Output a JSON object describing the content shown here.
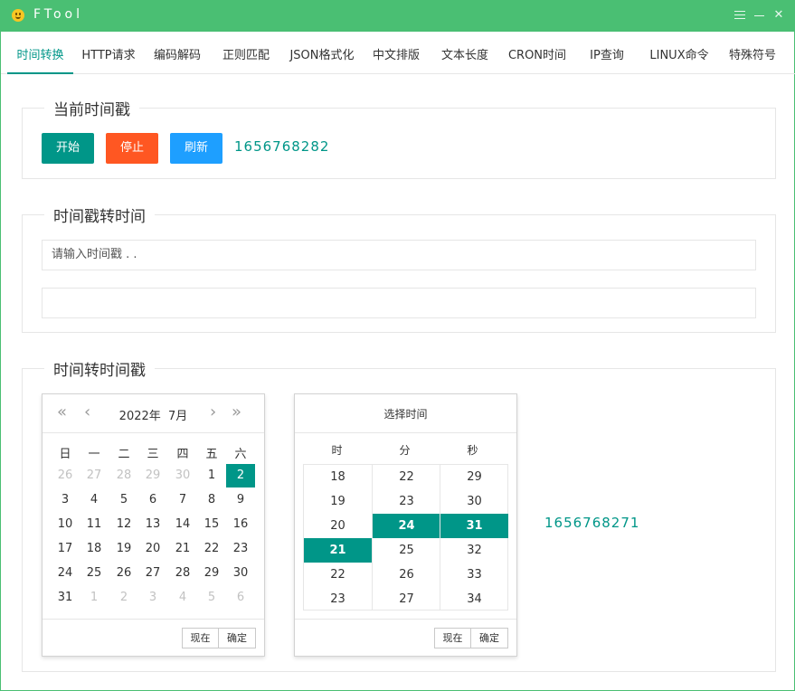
{
  "window": {
    "title": "FTool"
  },
  "tabs": [
    "时间转换",
    "HTTP请求",
    "编码解码",
    "正则匹配",
    "JSON格式化",
    "中文排版",
    "文本长度",
    "CRON时间",
    "IP查询",
    "LINUX命令",
    "特殊符号"
  ],
  "section_current": {
    "legend": "当前时间戳",
    "start_label": "开始",
    "stop_label": "停止",
    "refresh_label": "刷新",
    "timestamp": "1656768282"
  },
  "section_ts2time": {
    "legend": "时间戳转时间",
    "input_placeholder": "请输入时间戳 . .",
    "output_value": ""
  },
  "section_time2ts": {
    "legend": "时间转时间戳",
    "calendar": {
      "year_label": "2022年",
      "month_label": "7月",
      "weekdays": [
        "日",
        "一",
        "二",
        "三",
        "四",
        "五",
        "六"
      ],
      "days": [
        [
          "26",
          "27",
          "28",
          "29",
          "30",
          "1",
          "2"
        ],
        [
          "3",
          "4",
          "5",
          "6",
          "7",
          "8",
          "9"
        ],
        [
          "10",
          "11",
          "12",
          "13",
          "14",
          "15",
          "16"
        ],
        [
          "17",
          "18",
          "19",
          "20",
          "21",
          "22",
          "23"
        ],
        [
          "24",
          "25",
          "26",
          "27",
          "28",
          "29",
          "30"
        ],
        [
          "31",
          "1",
          "2",
          "3",
          "4",
          "5",
          "6"
        ]
      ],
      "now_label": "现在",
      "confirm_label": "确定"
    },
    "time_picker": {
      "title": "选择时间",
      "col_hour": "时",
      "col_minute": "分",
      "col_second": "秒",
      "hours": [
        "18",
        "19",
        "20",
        "21",
        "22",
        "23"
      ],
      "minutes": [
        "22",
        "23",
        "24",
        "25",
        "26",
        "27"
      ],
      "seconds": [
        "29",
        "30",
        "31",
        "32",
        "33",
        "34"
      ],
      "selected_hour": "21",
      "selected_minute": "24",
      "selected_second": "31",
      "now_label": "现在",
      "confirm_label": "确定"
    },
    "timestamp": "1656768271"
  },
  "colors": {
    "titlebar": "#4abf73",
    "accent": "#009688",
    "stop": "#ff5722",
    "refresh": "#1e9fff"
  }
}
